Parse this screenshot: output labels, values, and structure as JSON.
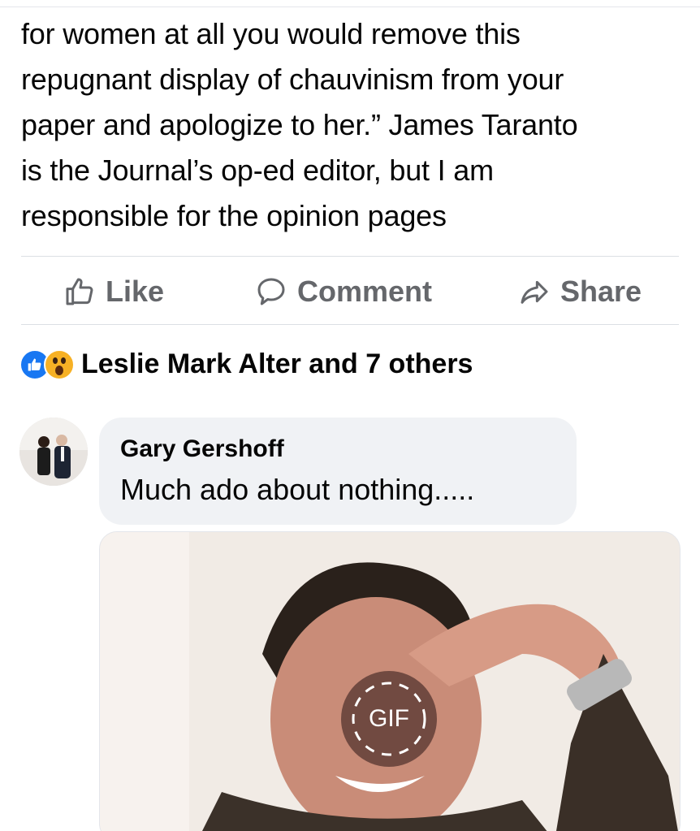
{
  "post": {
    "text_lines": [
      "for women at all you would remove this",
      "repugnant display of chauvinism from your",
      "paper and apologize to her.” James Taranto",
      "is the Journal’s op-ed editor, but I am",
      "responsible for the opinion pages"
    ]
  },
  "actions": {
    "like": "Like",
    "comment": "Comment",
    "share": "Share"
  },
  "reactions": {
    "icons": [
      "like-reaction-icon",
      "wow-reaction-icon"
    ],
    "summary": "Leslie Mark Alter and 7 others"
  },
  "comment": {
    "author": "Gary Gershoff",
    "text": "Much ado about nothing.....",
    "gif_label": "GIF"
  },
  "colors": {
    "text": "#050505",
    "muted": "#65676b",
    "like_blue": "#1877f2",
    "wow_yellow": "#f7b125",
    "bubble_bg": "#f0f2f5"
  }
}
